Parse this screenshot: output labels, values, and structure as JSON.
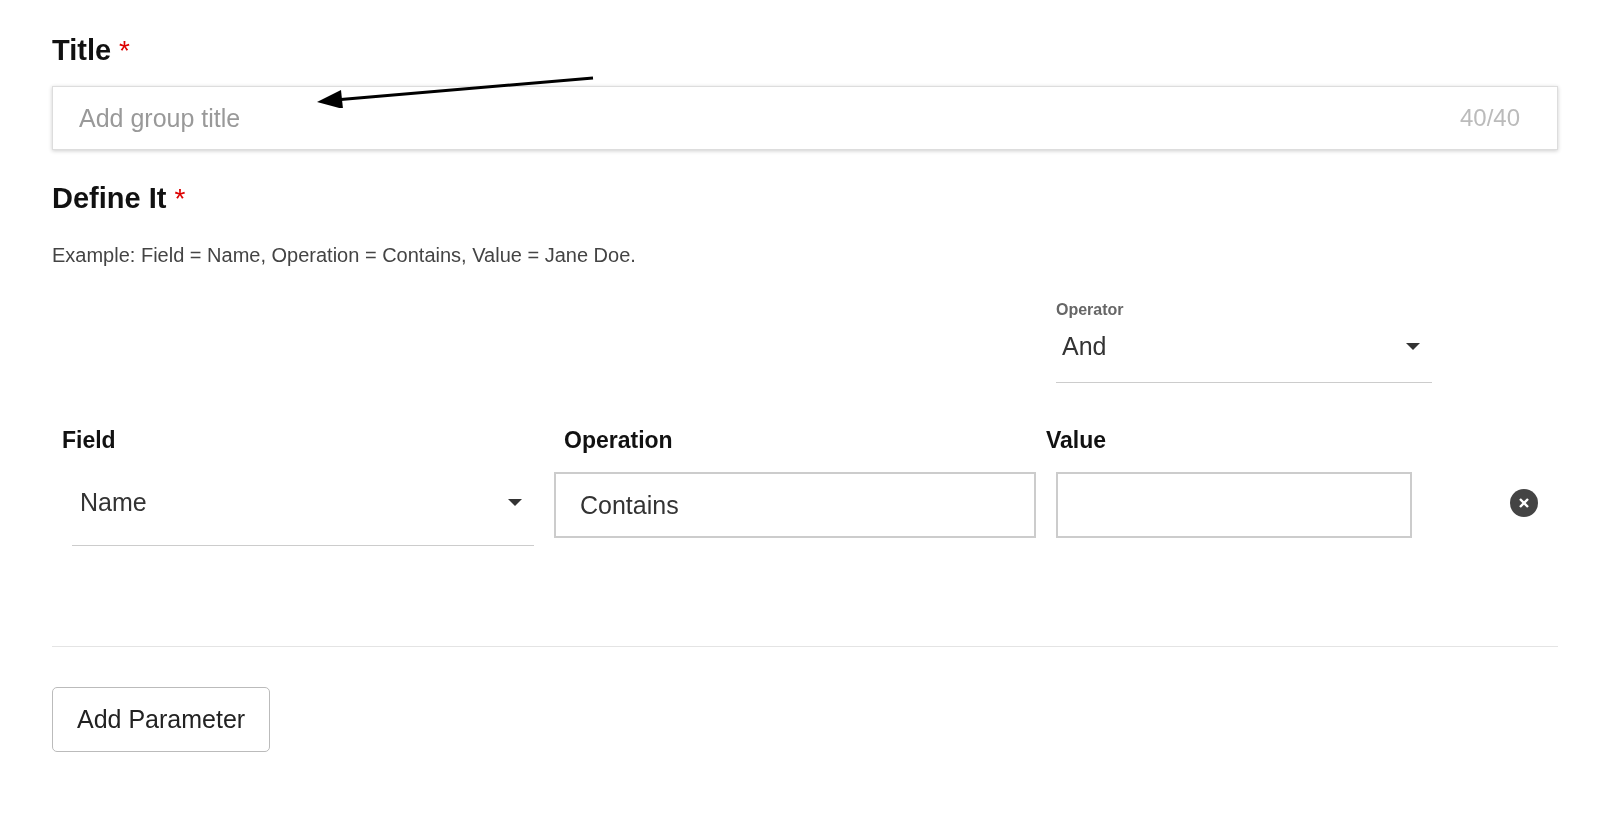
{
  "title_section": {
    "label": "Title",
    "required_mark": "*",
    "placeholder": "Add group title",
    "counter": "40/40"
  },
  "define_section": {
    "label": "Define It",
    "required_mark": "*",
    "hint": "Example: Field = Name, Operation = Contains, Value = Jane Doe.",
    "operator": {
      "label": "Operator",
      "value": "And"
    },
    "columns": [
      "Field",
      "Operation",
      "Value"
    ],
    "parameters": [
      {
        "field": "Name",
        "operation": "Contains"
      }
    ]
  },
  "buttons": [
    "Add Parameter"
  ]
}
